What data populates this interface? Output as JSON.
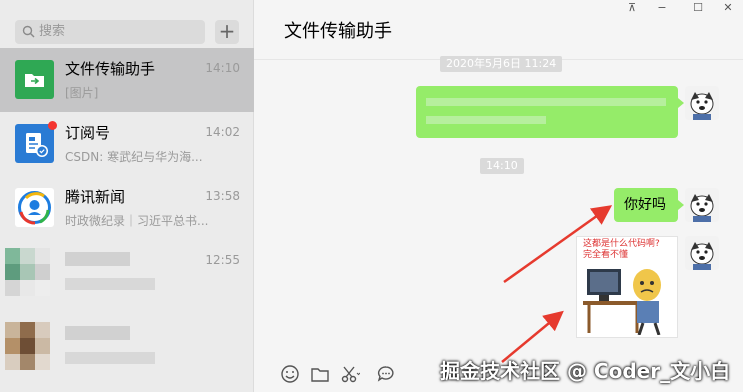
{
  "search": {
    "placeholder": "搜索",
    "add_label": "+"
  },
  "conversations": [
    {
      "name": "文件传输助手",
      "time": "14:10",
      "preview": "[图片]"
    },
    {
      "name": "订阅号",
      "time": "14:02",
      "preview": "CSDN: 寒武纪与华为海..."
    },
    {
      "name": "腾讯新闻",
      "time": "13:58",
      "preview": "时政微纪录｜习近平总书..."
    },
    {
      "name": "",
      "time": "12:55",
      "preview": ""
    },
    {
      "name": "",
      "time": "",
      "preview": ""
    }
  ],
  "chat": {
    "title": "文件传输助手",
    "timestamp1": "2020年5月6日 11:24",
    "timestamp2": "14:10",
    "msg_hello": "你好吗",
    "img_caption1": "这都是什么代码啊?",
    "img_caption2": "完全看不懂"
  },
  "window_controls": [
    "⊼",
    "−",
    "☐",
    "✕"
  ],
  "watermark": "掘金技术社区 @ Coder_文小白",
  "colors": {
    "bubble": "#95ec69",
    "selected": "#c5c5c6",
    "arrow": "#e63a2e"
  }
}
